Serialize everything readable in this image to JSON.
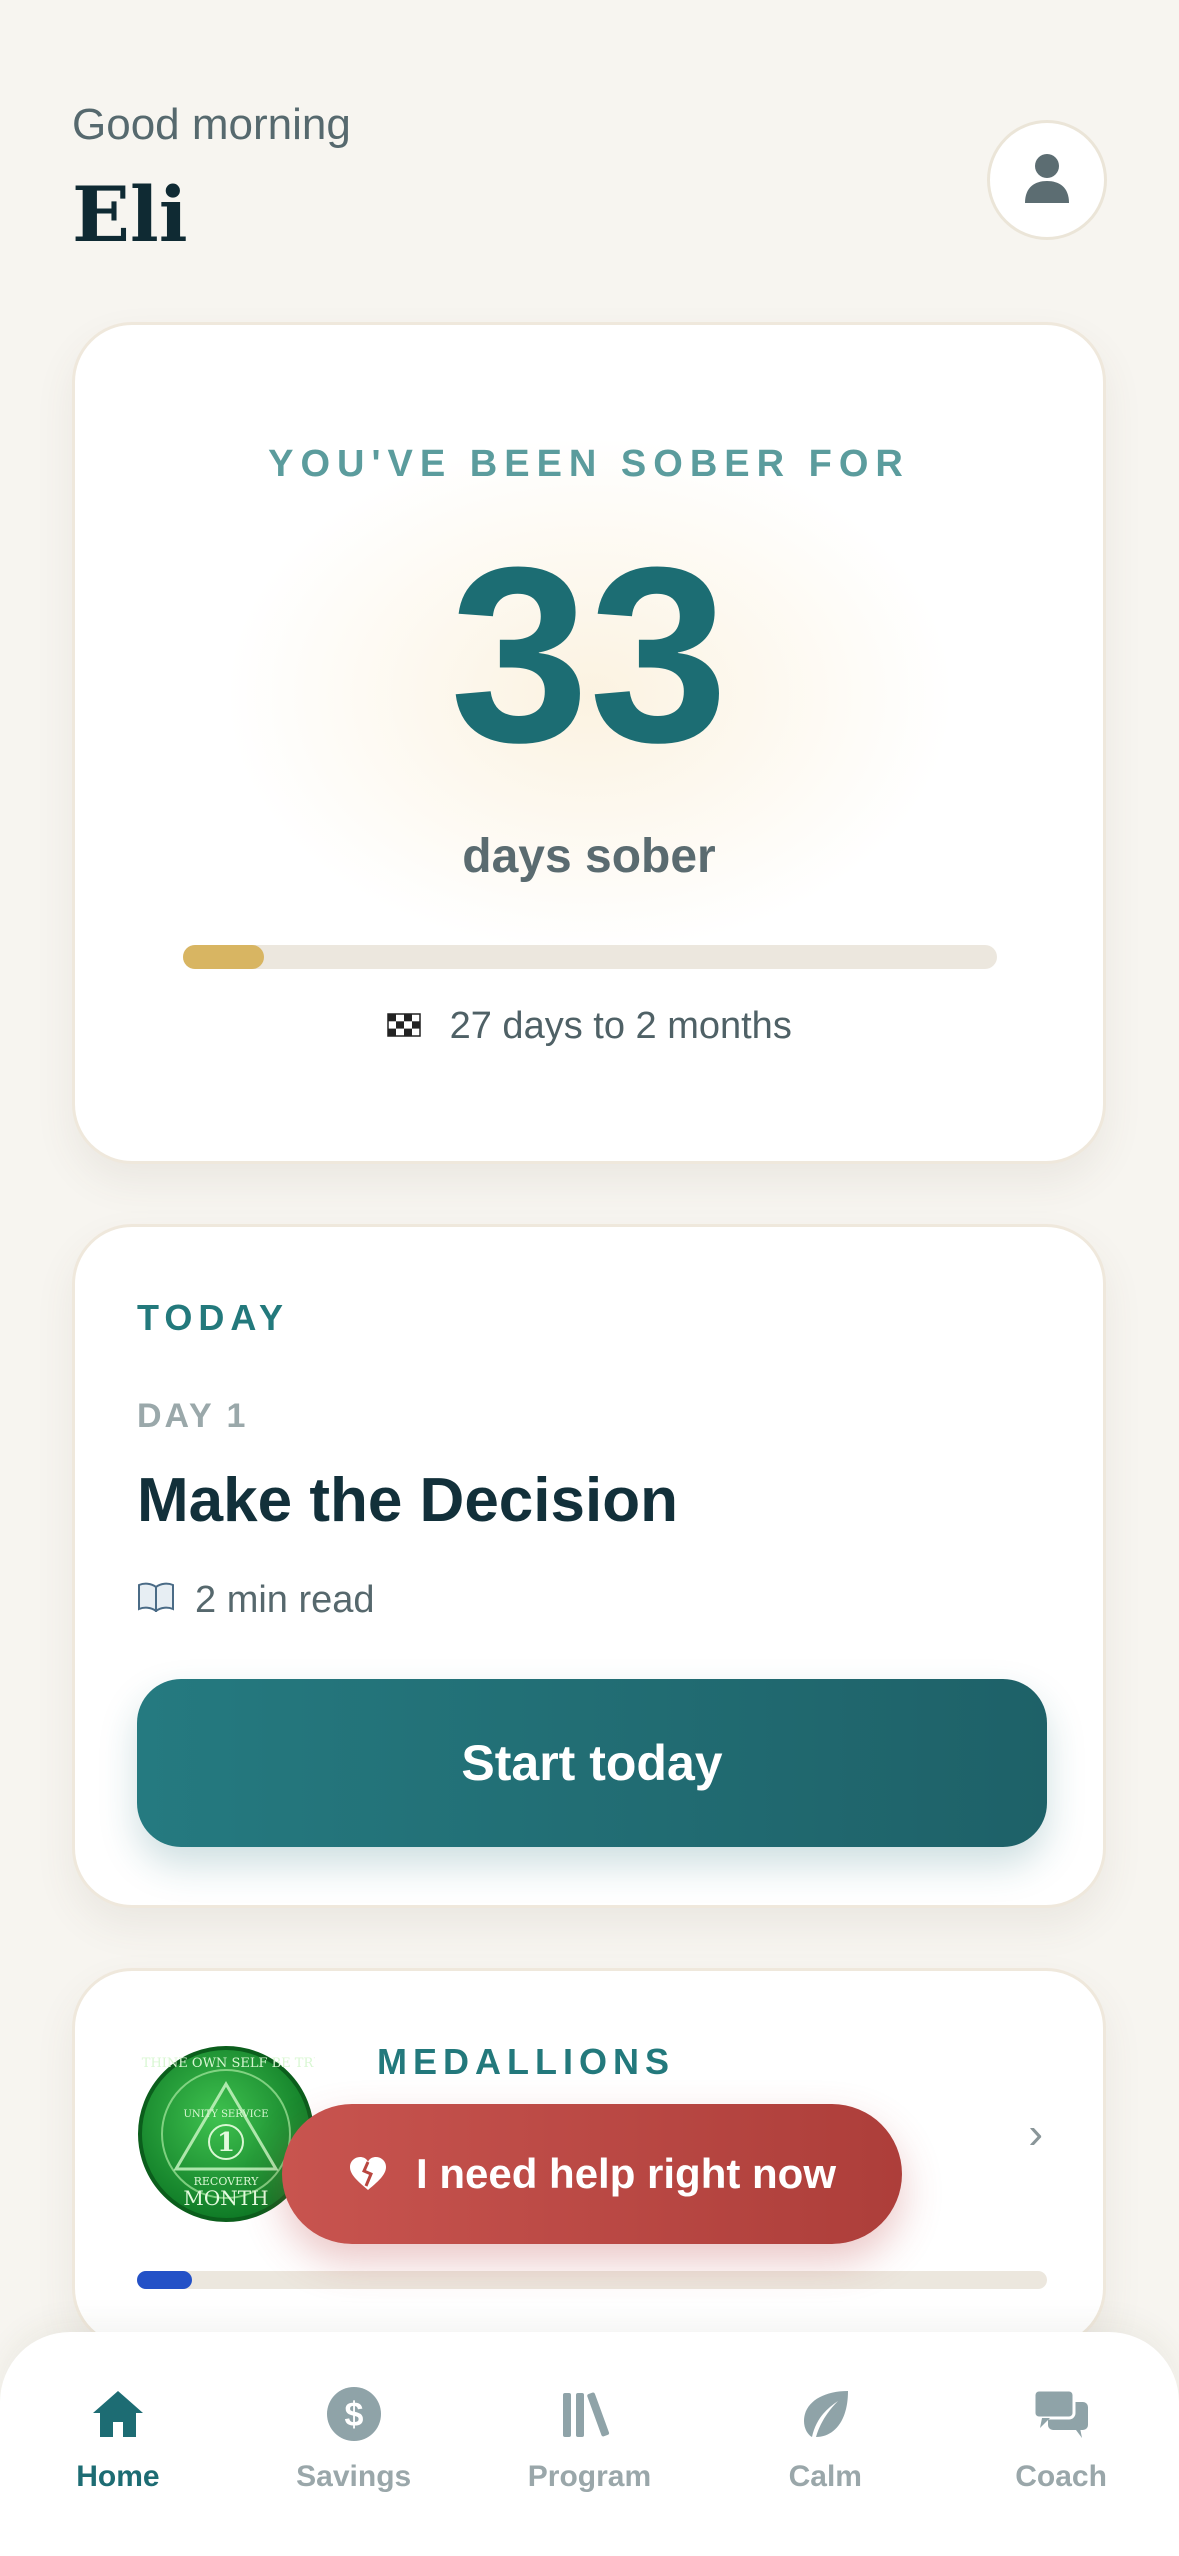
{
  "header": {
    "greeting": "Good morning",
    "user_name": "Eli",
    "profile_icon": "user-icon"
  },
  "sober_card": {
    "label": "YOU'VE BEEN SOBER FOR",
    "days_count": "33",
    "unit_label": "days sober",
    "progress_fraction": 0.1,
    "progress_color": "#d8b562",
    "milestone_icon": "checkered-flag-icon",
    "milestone_text": "27 days to 2 months"
  },
  "today_card": {
    "section_label": "TODAY",
    "day_label": "DAY 1",
    "lesson_title": "Make the Decision",
    "read_icon": "book-icon",
    "read_time": "2 min read",
    "start_button_label": "Start today"
  },
  "medallions_card": {
    "section_label": "MEDALLIONS",
    "medallion_text_top": "TO THINE OWN SELF BE TRUE",
    "medallion_text_middle": "UNITY SERVICE",
    "medallion_number": "1",
    "medallion_text_bottom": "RECOVERY",
    "medallion_month": "MONTH",
    "progress_fraction": 0.06,
    "progress_color": "#2451c7"
  },
  "help_button": {
    "label": "I need help right now",
    "icon": "broken-heart-icon"
  },
  "tabbar": {
    "tabs": [
      {
        "label": "Home",
        "icon": "home-icon",
        "active": true
      },
      {
        "label": "Savings",
        "icon": "dollar-icon",
        "active": false
      },
      {
        "label": "Program",
        "icon": "library-icon",
        "active": false
      },
      {
        "label": "Calm",
        "icon": "leaf-icon",
        "active": false
      },
      {
        "label": "Coach",
        "icon": "chat-icon",
        "active": false
      }
    ]
  },
  "colors": {
    "accent_teal": "#1d6c73",
    "help_red": "#c0504c",
    "background": "#f7f5f0"
  }
}
